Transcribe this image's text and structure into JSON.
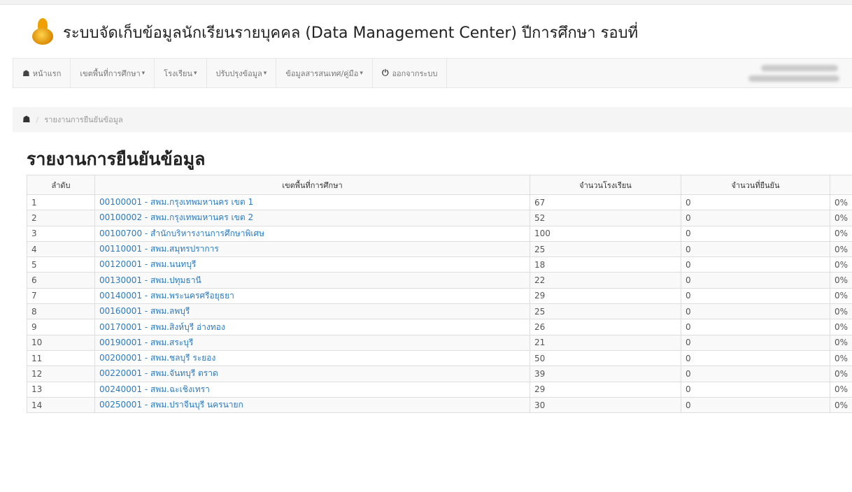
{
  "app": {
    "title": "ระบบจัดเก็บข้อมูลนักเรียนรายบุคคล (Data Management Center) ปีการศึกษา รอบที่"
  },
  "navbar": {
    "items": [
      {
        "label": "หน้าแรก",
        "icon": "home-icon"
      },
      {
        "label": "เขตพื้นที่การศึกษา",
        "dropdown": true
      },
      {
        "label": "โรงเรียน",
        "dropdown": true
      },
      {
        "label": "ปรับปรุงข้อมูล",
        "dropdown": true
      },
      {
        "label": "ข้อมูลสารสนเทศ/คู่มือ",
        "dropdown": true
      },
      {
        "label": "ออกจากระบบ",
        "icon": "power-icon"
      }
    ]
  },
  "breadcrumb": {
    "current": "รายงานการยืนยันข้อมูล"
  },
  "page": {
    "title": "รายงานการยืนยันข้อมูล"
  },
  "table": {
    "headers": [
      "ลำดับ",
      "เขตพื้นที่การศึกษา",
      "จำนวนโรงเรียน",
      "จำนวนที่ยืนยัน",
      ""
    ],
    "rows": [
      {
        "no": "1",
        "area": "00100001 - สพม.กรุงเทพมหานคร เขต 1",
        "schools": "67",
        "confirmed": "0",
        "percent": "0%"
      },
      {
        "no": "2",
        "area": "00100002 - สพม.กรุงเทพมหานคร เขต 2",
        "schools": "52",
        "confirmed": "0",
        "percent": "0%"
      },
      {
        "no": "3",
        "area": "00100700 - สำนักบริหารงานการศึกษาพิเศษ",
        "schools": "100",
        "confirmed": "0",
        "percent": "0%"
      },
      {
        "no": "4",
        "area": "00110001 - สพม.สมุทรปราการ",
        "schools": "25",
        "confirmed": "0",
        "percent": "0%"
      },
      {
        "no": "5",
        "area": "00120001 - สพม.นนทบุรี",
        "schools": "18",
        "confirmed": "0",
        "percent": "0%"
      },
      {
        "no": "6",
        "area": "00130001 - สพม.ปทุมธานี",
        "schools": "22",
        "confirmed": "0",
        "percent": "0%"
      },
      {
        "no": "7",
        "area": "00140001 - สพม.พระนครศรีอยุธยา",
        "schools": "29",
        "confirmed": "0",
        "percent": "0%"
      },
      {
        "no": "8",
        "area": "00160001 - สพม.ลพบุรี",
        "schools": "25",
        "confirmed": "0",
        "percent": "0%"
      },
      {
        "no": "9",
        "area": "00170001 - สพม.สิงห์บุรี อ่างทอง",
        "schools": "26",
        "confirmed": "0",
        "percent": "0%"
      },
      {
        "no": "10",
        "area": "00190001 - สพม.สระบุรี",
        "schools": "21",
        "confirmed": "0",
        "percent": "0%"
      },
      {
        "no": "11",
        "area": "00200001 - สพม.ชลบุรี ระยอง",
        "schools": "50",
        "confirmed": "0",
        "percent": "0%"
      },
      {
        "no": "12",
        "area": "00220001 - สพม.จันทบุรี ตราด",
        "schools": "39",
        "confirmed": "0",
        "percent": "0%"
      },
      {
        "no": "13",
        "area": "00240001 - สพม.ฉะเชิงเทรา",
        "schools": "29",
        "confirmed": "0",
        "percent": "0%"
      },
      {
        "no": "14",
        "area": "00250001 - สพม.ปราจีนบุรี นครนายก",
        "schools": "30",
        "confirmed": "0",
        "percent": "0%"
      }
    ]
  },
  "colors": {
    "link": "#2a7bbf",
    "navbar_bg": "#f8f8f8",
    "breadcrumb_bg": "#f5f5f5"
  }
}
